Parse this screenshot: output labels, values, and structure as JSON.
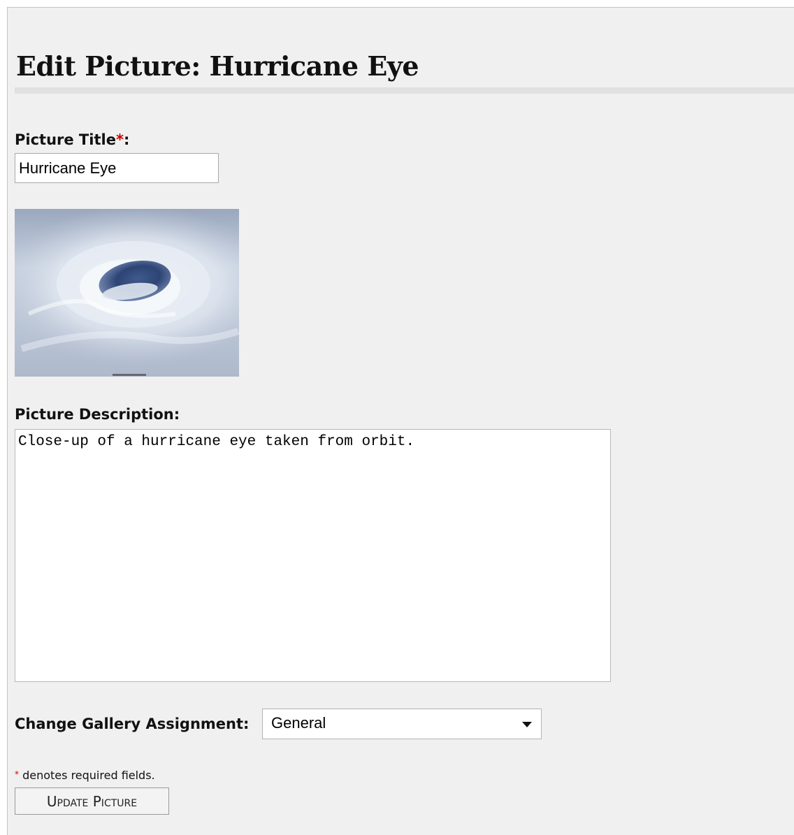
{
  "page": {
    "title": "Edit Picture: Hurricane Eye"
  },
  "form": {
    "title_label": "Picture Title",
    "title_label_suffix": ":",
    "required_marker": "*",
    "title_value": "Hurricane Eye",
    "picture_alt": "Hurricane Eye",
    "description_label": "Picture Description:",
    "description_value": "Close-up of a hurricane eye taken from orbit.",
    "gallery_label": "Change Gallery Assignment:",
    "gallery_selected": "General",
    "required_note": "denotes required fields.",
    "submit_label": "Update Picture"
  },
  "colors": {
    "panel_background": "#f0f0f0",
    "required_star": "#cc0000"
  }
}
